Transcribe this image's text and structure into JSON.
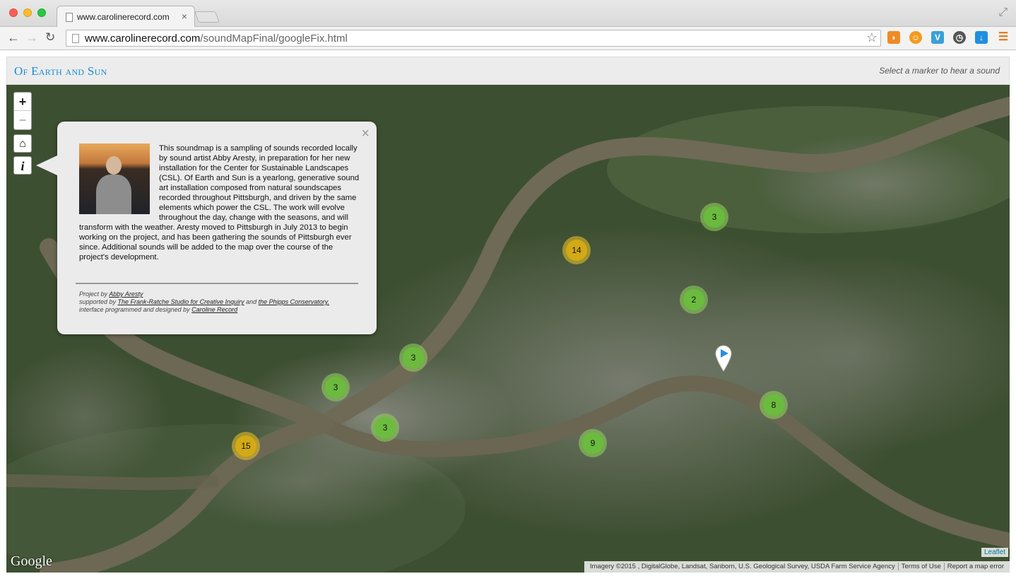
{
  "browser": {
    "tab_title": "www.carolinerecord.com",
    "tab_close": "×",
    "url_host": "www.carolinerecord.com",
    "url_path": "/soundMapFinal/googleFix.html"
  },
  "header": {
    "title": "Of Earth and Sun",
    "hint": "Select a marker to hear a sound"
  },
  "controls": {
    "zoom_in": "+",
    "zoom_out": "−",
    "home_icon": "⌂",
    "info_icon": "i"
  },
  "info_panel": {
    "close": "×",
    "body": "This soundmap is a sampling of sounds recorded locally by sound artist Abby Aresty, in preparation for her new installation for the Center for Sustainable Landscapes (CSL). Of Earth and Sun is a yearlong, generative sound art installation composed from natural soundscapes recorded throughout Pittsburgh, and driven by the same elements which power the CSL. The work will evolve throughout the day, change with the seasons, and will transform with the weather. Aresty moved to Pittsburgh in July 2013 to begin working on the project, and has been gathering the sounds of Pittsburgh ever since. Additional sounds will be added to the map over the course of the project's development.",
    "credit_project_prefix": "Project by ",
    "credit_project_link": "Abby Aresty",
    "credit_support_prefix": "supported by ",
    "credit_support_link1": "The Frank-Ratche Studio for Creative Inquiry",
    "credit_support_and": " and ",
    "credit_support_link2": "the Phipps Conservatory.",
    "credit_interface_prefix": "interface programmed and designed by ",
    "credit_interface_link": "Caroline Record"
  },
  "clusters": [
    {
      "label": "3",
      "color": "green"
    },
    {
      "label": "14",
      "color": "yellow"
    },
    {
      "label": "2",
      "color": "green"
    },
    {
      "label": "3",
      "color": "green"
    },
    {
      "label": "3",
      "color": "green"
    },
    {
      "label": "3",
      "color": "green"
    },
    {
      "label": "15",
      "color": "yellow"
    },
    {
      "label": "9",
      "color": "green"
    },
    {
      "label": "8",
      "color": "green"
    }
  ],
  "map": {
    "google_logo": "Google",
    "leaflet_link": "Leaflet",
    "imagery_credit": "Imagery ©2015 , DigitalGlobe, Landsat, Sanborn, U.S. Geological Survey, USDA Farm Service Agency",
    "terms": "Terms of Use",
    "report": "Report a map error"
  },
  "colors": {
    "accent": "#1b8ad6",
    "cluster_green": "#69be3c",
    "cluster_yellow": "#d7aa14",
    "marker_blue": "#2a8ee0"
  }
}
